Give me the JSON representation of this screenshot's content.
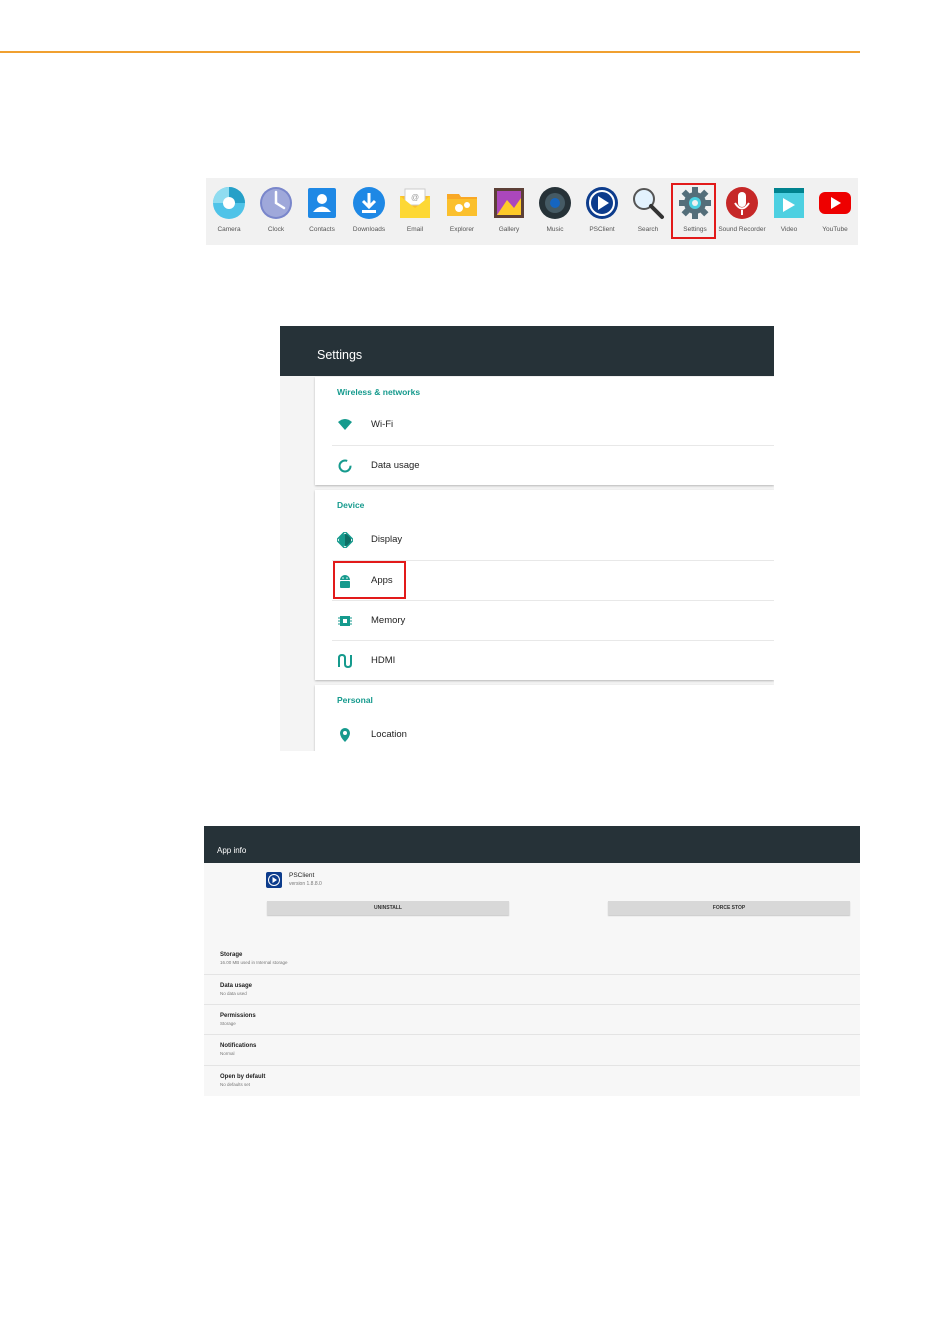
{
  "drawer": {
    "apps": [
      {
        "label": "Camera",
        "icon": "camera-icon"
      },
      {
        "label": "Clock",
        "icon": "clock-icon"
      },
      {
        "label": "Contacts",
        "icon": "contacts-icon"
      },
      {
        "label": "Downloads",
        "icon": "downloads-icon"
      },
      {
        "label": "Email",
        "icon": "email-icon"
      },
      {
        "label": "Explorer",
        "icon": "explorer-icon"
      },
      {
        "label": "Gallery",
        "icon": "gallery-icon"
      },
      {
        "label": "Music",
        "icon": "music-icon"
      },
      {
        "label": "PSClient",
        "icon": "psclient-icon"
      },
      {
        "label": "Search",
        "icon": "search-icon"
      },
      {
        "label": "Settings",
        "icon": "settings-icon"
      },
      {
        "label": "Sound Recorder",
        "icon": "microphone-icon"
      },
      {
        "label": "Video",
        "icon": "video-icon"
      },
      {
        "label": "YouTube",
        "icon": "youtube-icon"
      }
    ]
  },
  "settings": {
    "title": "Settings",
    "sections": [
      {
        "header": "Wireless & networks",
        "items": [
          {
            "label": "Wi-Fi",
            "icon": "wifi-icon"
          },
          {
            "label": "Data usage",
            "icon": "data-usage-icon"
          }
        ]
      },
      {
        "header": "Device",
        "items": [
          {
            "label": "Display",
            "icon": "display-icon"
          },
          {
            "label": "Apps",
            "icon": "android-icon"
          },
          {
            "label": "Memory",
            "icon": "memory-icon"
          },
          {
            "label": "HDMI",
            "icon": "hdmi-icon"
          }
        ]
      },
      {
        "header": "Personal",
        "items": [
          {
            "label": "Location",
            "icon": "location-pin-icon"
          }
        ]
      }
    ]
  },
  "appinfo": {
    "title": "App info",
    "app_name": "PSClient",
    "version": "version 1.8.8.0",
    "uninstall_label": "UNINSTALL",
    "force_stop_label": "FORCE STOP",
    "rows": [
      {
        "title": "Storage",
        "sub": "16.00 MB used in Internal storage"
      },
      {
        "title": "Data usage",
        "sub": "No data used"
      },
      {
        "title": "Permissions",
        "sub": "Storage"
      },
      {
        "title": "Notifications",
        "sub": "Normal"
      },
      {
        "title": "Open by default",
        "sub": "No defaults set"
      }
    ]
  },
  "colors": {
    "accent": "#f0a030",
    "teal": "#159a8d",
    "toolbar": "#263238",
    "highlight": "#e21a1a"
  }
}
